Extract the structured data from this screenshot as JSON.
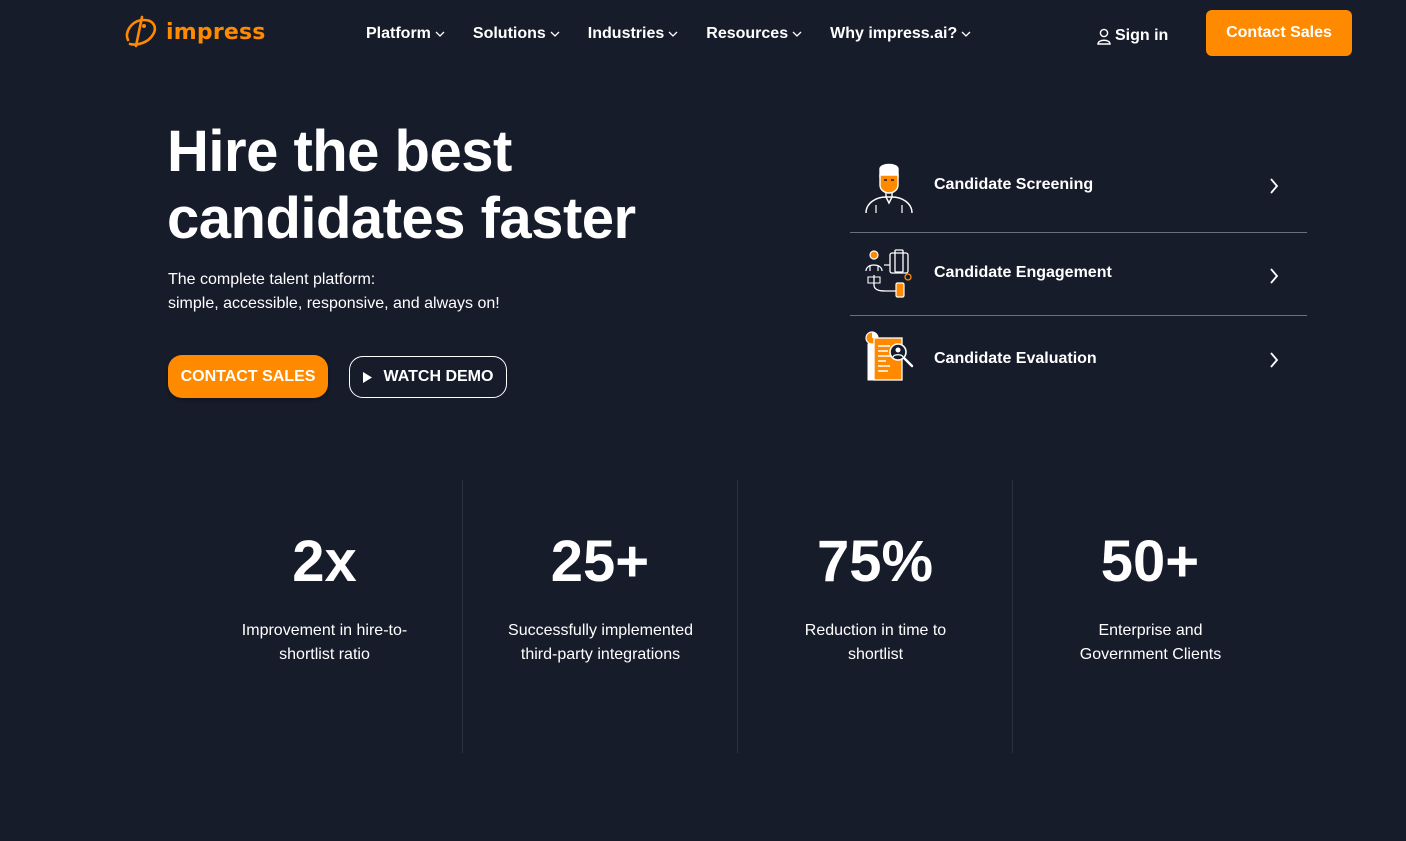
{
  "brand": {
    "name": "impress",
    "accent": "#ff8a00",
    "background": "#171c2b"
  },
  "nav": {
    "items": [
      {
        "label": "Platform",
        "icon": "chevron-down-icon"
      },
      {
        "label": "Solutions",
        "icon": "chevron-down-icon"
      },
      {
        "label": "Industries",
        "icon": "chevron-down-icon"
      },
      {
        "label": "Resources",
        "icon": "chevron-down-icon"
      },
      {
        "label": "Why impress.ai?",
        "icon": "chevron-down-icon"
      }
    ],
    "signin_label": "Sign in",
    "cta_label": "Contact Sales"
  },
  "hero": {
    "title": "Hire the best candidates faster",
    "subtitle_line1": "The complete talent platform:",
    "subtitle_line2": "simple, accessible, responsive, and always on!",
    "primary_button": "CONTACT SALES",
    "secondary_button": "WATCH DEMO"
  },
  "features": [
    {
      "label": "Candidate Screening",
      "icon": "candidate-screening-icon"
    },
    {
      "label": "Candidate Engagement",
      "icon": "candidate-engagement-icon"
    },
    {
      "label": "Candidate Evaluation",
      "icon": "candidate-evaluation-icon"
    }
  ],
  "stats": [
    {
      "value": "2x",
      "label": "Improvement in hire-to-shortlist ratio"
    },
    {
      "value": "25+",
      "label": "Successfully implemented third-party integrations"
    },
    {
      "value": "75%",
      "label": "Reduction in time to shortlist"
    },
    {
      "value": "50+",
      "label": "Enterprise and Government Clients"
    }
  ]
}
